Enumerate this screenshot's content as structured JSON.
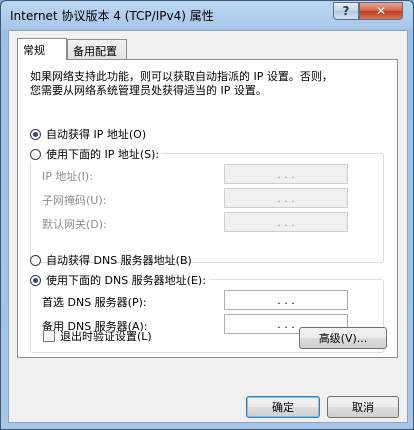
{
  "window": {
    "title": "Internet 协议版本 4 (TCP/IPv4) 属性",
    "help_label": "?",
    "close_label": "✕"
  },
  "tabs": [
    {
      "label": "常规",
      "active": true
    },
    {
      "label": "备用配置",
      "active": false
    }
  ],
  "intro": {
    "line1": "如果网络支持此功能，则可以获取自动指派的 IP 设置。否则，",
    "line2": "您需要从网络系统管理员处获得适当的 IP 设置。"
  },
  "ip_section": {
    "auto_label": "自动获得 IP 地址(O)",
    "auto_selected": true,
    "manual_label": "使用下面的 IP 地址(S):",
    "manual_selected": false,
    "fields": [
      {
        "label": "IP 地址(I):",
        "value": ". . ."
      },
      {
        "label": "子网掩码(U):",
        "value": ". . ."
      },
      {
        "label": "默认网关(D):",
        "value": ". . ."
      }
    ]
  },
  "dns_section": {
    "auto_label": "自动获得 DNS 服务器地址(B)",
    "auto_selected": false,
    "manual_label": "使用下面的 DNS 服务器地址(E):",
    "manual_selected": true,
    "fields": [
      {
        "label": "首选 DNS 服务器(P):",
        "value": ". . ."
      },
      {
        "label": "备用 DNS 服务器(A):",
        "value": ". . ."
      }
    ]
  },
  "validate": {
    "label": "退出时验证设置(L)",
    "checked": false
  },
  "buttons": {
    "advanced": "高级(V)...",
    "ok": "确定",
    "cancel": "取消"
  },
  "colors": {
    "title_bar": "#a9c8ea",
    "close_button": "#c8492a",
    "radio_dot": "#2a4a8a"
  }
}
